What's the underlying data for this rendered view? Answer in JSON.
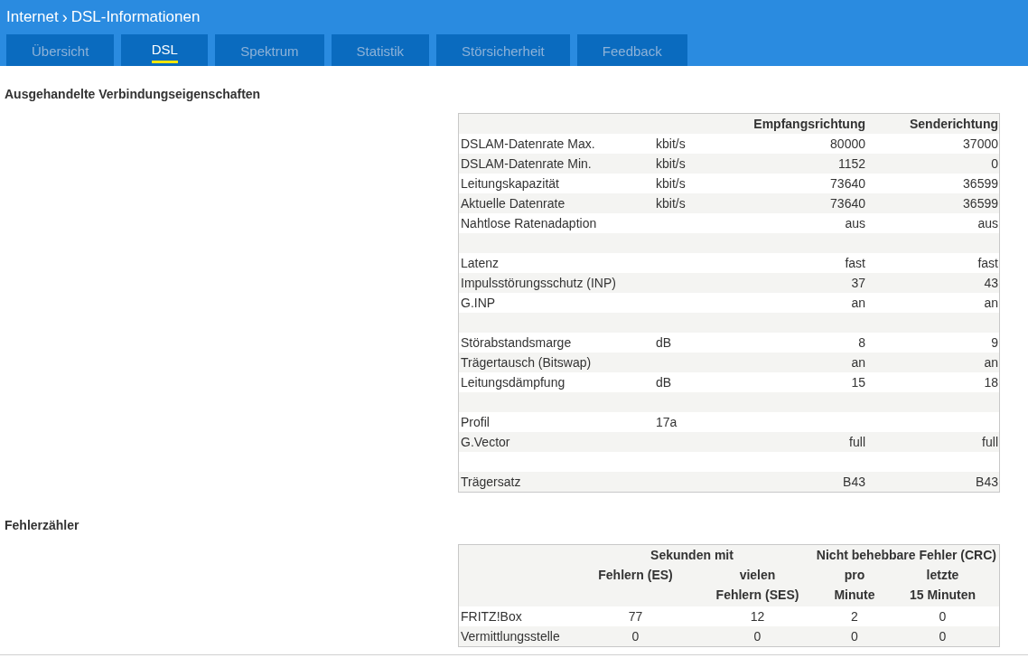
{
  "breadcrumb": {
    "parent": "Internet",
    "separator": "›",
    "current": "DSL-Informationen"
  },
  "tabs": [
    {
      "label": "Übersicht",
      "selected": false
    },
    {
      "label": "DSL",
      "selected": true
    },
    {
      "label": "Spektrum",
      "selected": false
    },
    {
      "label": "Statistik",
      "selected": false
    },
    {
      "label": "Störsicherheit",
      "selected": false
    },
    {
      "label": "Feedback",
      "selected": false
    }
  ],
  "connection": {
    "heading": "Ausgehandelte Verbindungseigenschaften",
    "columns": [
      "Empfangsrichtung",
      "Senderichtung"
    ],
    "rows": [
      {
        "kind": "data",
        "label": "DSLAM-Datenrate Max.",
        "unit": "kbit/s",
        "receive": "80000",
        "send": "37000"
      },
      {
        "kind": "data",
        "label": "DSLAM-Datenrate Min.",
        "unit": "kbit/s",
        "receive": "1152",
        "send": "0"
      },
      {
        "kind": "data",
        "label": "Leitungskapazität",
        "unit": "kbit/s",
        "receive": "73640",
        "send": "36599"
      },
      {
        "kind": "data",
        "label": "Aktuelle Datenrate",
        "unit": "kbit/s",
        "receive": "73640",
        "send": "36599"
      },
      {
        "kind": "data",
        "label": "Nahtlose Ratenadaption",
        "receive": "aus",
        "send": "aus"
      },
      {
        "kind": "spacer"
      },
      {
        "kind": "data",
        "label": "Latenz",
        "receive": "fast",
        "send": "fast"
      },
      {
        "kind": "data",
        "label": "Impulsstörungsschutz (INP)",
        "receive": "37",
        "send": "43"
      },
      {
        "kind": "data",
        "label": "G.INP",
        "receive": "an",
        "send": "an"
      },
      {
        "kind": "spacer"
      },
      {
        "kind": "data",
        "label": "Störabstandsmarge",
        "unit": "dB",
        "receive": "8",
        "send": "9"
      },
      {
        "kind": "data",
        "label": "Trägertausch (Bitswap)",
        "receive": "an",
        "send": "an"
      },
      {
        "kind": "data",
        "label": "Leitungsdämpfung",
        "unit": "dB",
        "receive": "15",
        "send": "18"
      },
      {
        "kind": "spacer"
      },
      {
        "kind": "data",
        "label": "Profil",
        "unit": "17a"
      },
      {
        "kind": "data",
        "label": "G.Vector",
        "receive": "full",
        "send": "full"
      },
      {
        "kind": "spacer"
      },
      {
        "kind": "data",
        "label": "Trägersatz",
        "receive": "B43",
        "send": "B43"
      }
    ]
  },
  "errors": {
    "heading": "Fehlerzähler",
    "groups": [
      "Sekunden mit",
      "Nicht behebbare Fehler (CRC)"
    ],
    "columns": [
      [
        "Fehlern (ES)"
      ],
      [
        "vielen",
        "Fehlern (SES)"
      ],
      [
        "pro",
        "Minute"
      ],
      [
        "letzte",
        "15 Minuten"
      ]
    ],
    "rows": [
      {
        "label": "FRITZ!Box",
        "values": [
          "77",
          "12",
          "2",
          "0"
        ]
      },
      {
        "label": "Vermittlungsstelle",
        "values": [
          "0",
          "0",
          "0",
          "0"
        ]
      }
    ]
  }
}
